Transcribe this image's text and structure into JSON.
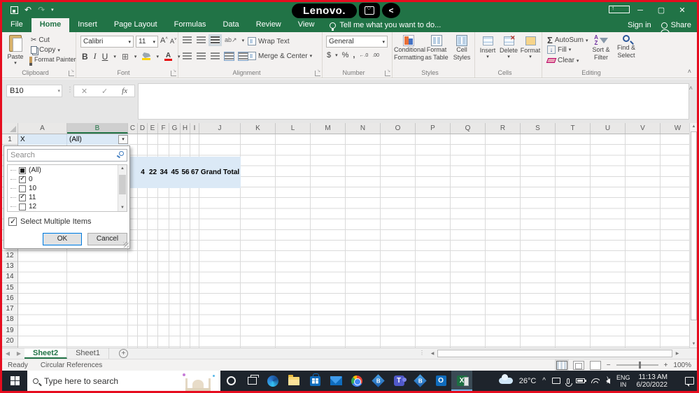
{
  "colors": {
    "excel_green": "#217346",
    "border_red": "#e60d1f",
    "pivot_fill": "#dbe9f6",
    "taskbar_bg": "#1e242c",
    "focus_blue": "#0078d7"
  },
  "title_bar": {
    "lenovo_label": "Lenovo.",
    "back_glyph": "<",
    "window_controls": {
      "minimize": "─",
      "restore": "▢",
      "close": "✕"
    }
  },
  "menu_bar": {
    "tabs": [
      "File",
      "Home",
      "Insert",
      "Page Layout",
      "Formulas",
      "Data",
      "Review",
      "View"
    ],
    "active_tab": "Home",
    "tell_me": "Tell me what you want to do...",
    "sign_in": "Sign in",
    "share": "Share"
  },
  "ribbon": {
    "clipboard": {
      "label": "Clipboard",
      "paste": "Paste",
      "cut": "Cut",
      "copy": "Copy",
      "format_painter": "Format Painter"
    },
    "font": {
      "label": "Font",
      "name": "Calibri",
      "size": "11",
      "bold": "B",
      "italic": "I",
      "underline": "U"
    },
    "alignment": {
      "label": "Alignment",
      "wrap_text": "Wrap Text",
      "merge_center": "Merge & Center"
    },
    "number": {
      "label": "Number",
      "format": "General",
      "currency": "$",
      "percent": "%",
      "comma": ",",
      "inc_dec": "←.0",
      "dec_dec": ".00"
    },
    "styles": {
      "label": "Styles",
      "conditional": "Conditional Formatting",
      "format_table": "Format as Table",
      "cell_styles": "Cell Styles"
    },
    "cells": {
      "label": "Cells",
      "insert": "Insert",
      "delete": "Delete",
      "format": "Format"
    },
    "editing": {
      "label": "Editing",
      "autosum": "AutoSum",
      "fill": "Fill",
      "clear": "Clear",
      "sort_filter": "Sort & Filter",
      "find_select": "Find & Select"
    }
  },
  "formula_bar": {
    "name_box": "B10",
    "cancel_glyph": "✕",
    "enter_glyph": "✓",
    "fx_glyph": "fx"
  },
  "sheet": {
    "columns": [
      "A",
      "B",
      "C",
      "D",
      "E",
      "F",
      "G",
      "H",
      "I",
      "J",
      "K",
      "L",
      "M",
      "N",
      "O",
      "P",
      "Q",
      "R",
      "S",
      "T",
      "U",
      "V",
      "W"
    ],
    "selected_column": "B",
    "row_numbers": [
      "1",
      "12",
      "13",
      "14",
      "15",
      "16",
      "17",
      "18",
      "19",
      "20"
    ],
    "cells": {
      "A1": "X",
      "B1": "(All)"
    },
    "pivot_row": {
      "values": [
        "4",
        "22",
        "34",
        "45",
        "56",
        "67",
        "Grand Total"
      ]
    }
  },
  "filter_popup": {
    "search_placeholder": "Search",
    "items": [
      {
        "label": "(All)",
        "state": "indeterminate"
      },
      {
        "label": "0",
        "state": "checked"
      },
      {
        "label": "10",
        "state": "unchecked"
      },
      {
        "label": "11",
        "state": "checked"
      },
      {
        "label": "12",
        "state": "unchecked"
      }
    ],
    "select_multiple_label": "Select Multiple Items",
    "ok_label": "OK",
    "cancel_label": "Cancel"
  },
  "sheet_tabs": {
    "active": "Sheet2",
    "inactive": "Sheet1",
    "add_glyph": "+"
  },
  "status_bar": {
    "mode": "Ready",
    "message": "Circular References",
    "zoom_level": "100%"
  },
  "taskbar": {
    "search_placeholder": "Type here to search",
    "temperature": "26°C",
    "language": "ENG",
    "region": "IN",
    "time": "11:13 AM",
    "date": "6/20/2022",
    "app_icons": [
      "cortana",
      "task-view",
      "edge",
      "file-explorer",
      "store",
      "mail",
      "chrome",
      "app-b",
      "teams",
      "app-b",
      "outlook",
      "excel"
    ]
  },
  "icons": {
    "undo": "↶",
    "redo": "↷",
    "qat_more": "▾",
    "dropdown": "▾",
    "up_small": "▲",
    "down_small": "▼",
    "left_small": "◀",
    "right_small": "▶",
    "collapse": "˄",
    "sigma": "Σ",
    "scissors": "✂",
    "borders": "⊞",
    "chevron_up": "^",
    "teams_t": "T",
    "outlook_o": "O",
    "excel_x": "X",
    "app_b": "B"
  }
}
